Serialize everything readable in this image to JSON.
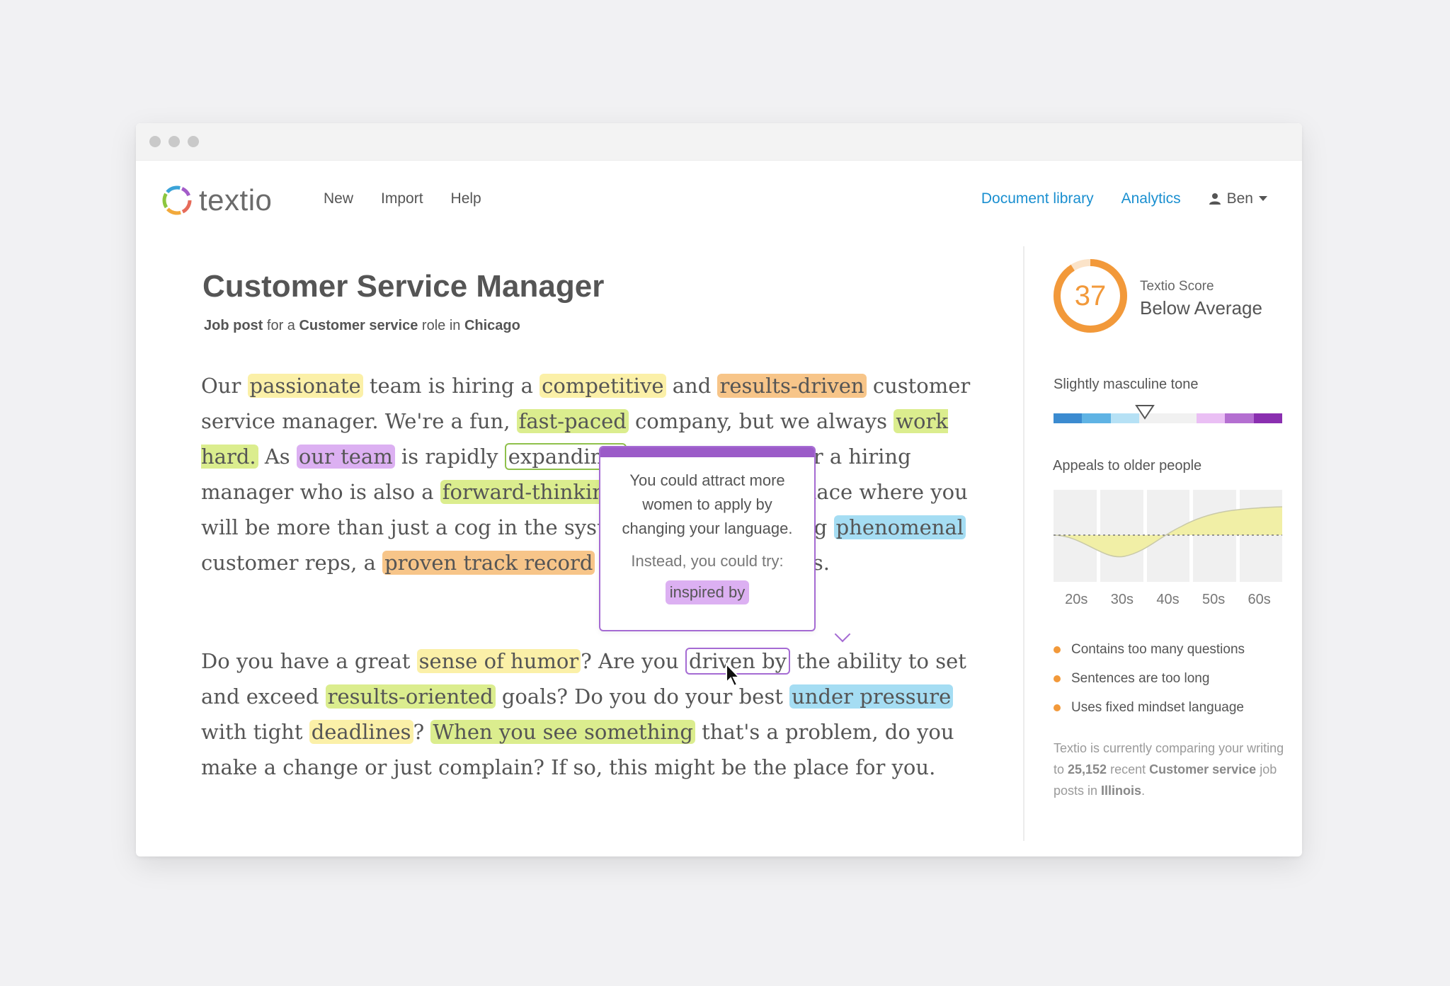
{
  "app": {
    "logo_text": "textio",
    "nav_left": [
      "New",
      "Import",
      "Help"
    ],
    "nav_right": {
      "document_library": "Document library",
      "analytics": "Analytics",
      "user": "Ben"
    }
  },
  "document": {
    "title": "Customer Service Manager",
    "subtitle": {
      "p1": "Job post",
      "p2": " for a ",
      "p3": "Customer service",
      "p4": " role in ",
      "p5": "Chicago"
    },
    "para1": [
      {
        "t": "Our "
      },
      {
        "t": "passionate",
        "c": "y",
        "n": "highlight-passionate"
      },
      {
        "t": " team is hiring a "
      },
      {
        "t": "competitive",
        "c": "y",
        "n": "highlight-competitive"
      },
      {
        "t": " and "
      },
      {
        "t": "results-driven",
        "c": "o",
        "n": "highlight-results-driven"
      },
      {
        "t": " customer service manager. We're a fun, "
      },
      {
        "t": "fast-paced",
        "c": "g",
        "n": "highlight-fast-paced"
      },
      {
        "t": " company, but we always "
      },
      {
        "t": "work hard.",
        "c": "g",
        "n": "highlight-work-hard"
      },
      {
        "t": " As "
      },
      {
        "t": "our team",
        "c": "p",
        "n": "highlight-our-team"
      },
      {
        "t": " is rapidly "
      },
      {
        "t": "expanding,",
        "c": "box-g",
        "n": "highlight-expanding"
      },
      {
        "t": " we are looking for a hiring manager who is also a "
      },
      {
        "t": "forward-thinking",
        "c": "g",
        "n": "highlight-forward-thinking"
      },
      {
        "t": " leader. This is a place where you will be more than just a cog in the system. We value leading "
      },
      {
        "t": "phenomenal",
        "c": "b",
        "n": "highlight-phenomenal"
      },
      {
        "t": " customer reps, a "
      },
      {
        "t": "proven track record",
        "c": "o",
        "n": "highlight-proven-track-record"
      },
      {
        "t": " would be a huge plus."
      }
    ],
    "para2": [
      {
        "t": "Do you have a great "
      },
      {
        "t": "sense of humor",
        "c": "y",
        "n": "highlight-sense-of-humor"
      },
      {
        "t": "? Are you "
      },
      {
        "t": "driven by",
        "c": "box-p",
        "n": "highlight-driven-by"
      },
      {
        "t": " the ability to set and exceed "
      },
      {
        "t": "results-oriented",
        "c": "g",
        "n": "highlight-results-oriented"
      },
      {
        "t": " goals? Do you do your best "
      },
      {
        "t": "under pressure",
        "c": "b",
        "n": "highlight-under-pressure"
      },
      {
        "t": " with tight "
      },
      {
        "t": "deadlines",
        "c": "y",
        "n": "highlight-deadlines"
      },
      {
        "t": "? "
      },
      {
        "t": "When you see something",
        "c": "g",
        "n": "highlight-when-you-see-something"
      },
      {
        "t": " that's a problem, do you make a change or just complain? If so, this might be the place for you."
      }
    ]
  },
  "tooltip": {
    "message": "You could attract more women to apply by changing your language.",
    "try_label": "Instead, you could try:",
    "suggestion": "inspired by"
  },
  "sidebar": {
    "score": "37",
    "score_fraction": 0.37,
    "score_label": "Textio Score",
    "score_status": "Below Average",
    "tone_label": "Slightly masculine tone",
    "tone_colors": [
      "#3b8bd0",
      "#5fb3e4",
      "#b6e1f5",
      "#f1f1f1",
      "#f1f1f1",
      "#eabff4",
      "#b46fd1",
      "#8a2fb0"
    ],
    "tone_position": 0.4,
    "age_label": "Appeals to older people",
    "age_ticks": [
      "20s",
      "30s",
      "40s",
      "50s",
      "60s"
    ],
    "issues": [
      "Contains too many questions",
      "Sentences are too long",
      "Uses fixed mindset language"
    ],
    "footnote": {
      "f1": "Textio is currently comparing your writing to ",
      "f2": "25,152",
      "f3": " recent ",
      "f4": "Customer service",
      "f5": " job posts in ",
      "f6": "Illinois",
      "f7": "."
    },
    "accent_orange": "#f2993a"
  }
}
